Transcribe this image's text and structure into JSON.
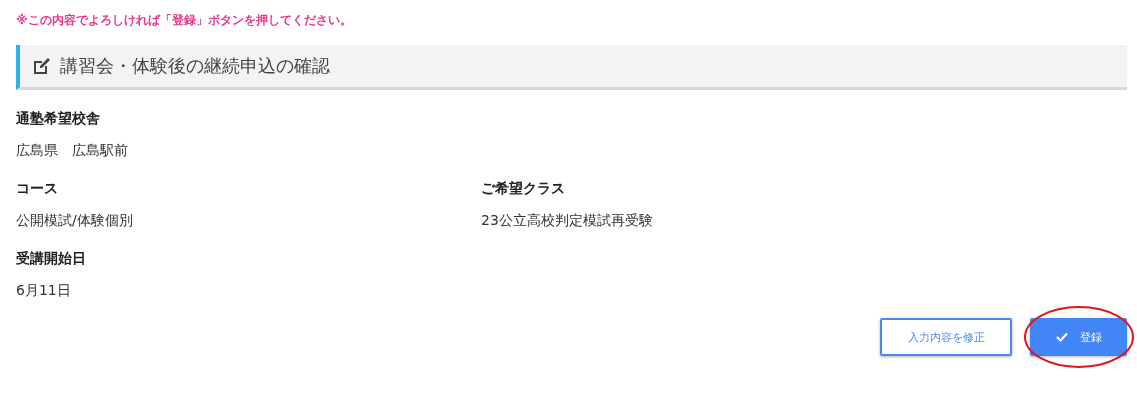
{
  "notice": "※この内容でよろしければ「登録」ボタンを押してください。",
  "section": {
    "title": "講習会・体験後の継続申込の確認"
  },
  "fields": [
    [
      {
        "label": "通塾希望校舎",
        "value": "広島県　広島駅前"
      }
    ],
    [
      {
        "label": "コース",
        "value": "公開模試/体験個別"
      },
      {
        "label": "ご希望クラス",
        "value": "23公立高校判定模試再受験"
      }
    ],
    [
      {
        "label": "受講開始日",
        "value": "6月11日"
      }
    ]
  ],
  "buttons": [
    {
      "kind": "secondary",
      "label": "入力内容を修正",
      "highlighted": false
    },
    {
      "kind": "primary",
      "label": "登録",
      "highlighted": true
    }
  ]
}
